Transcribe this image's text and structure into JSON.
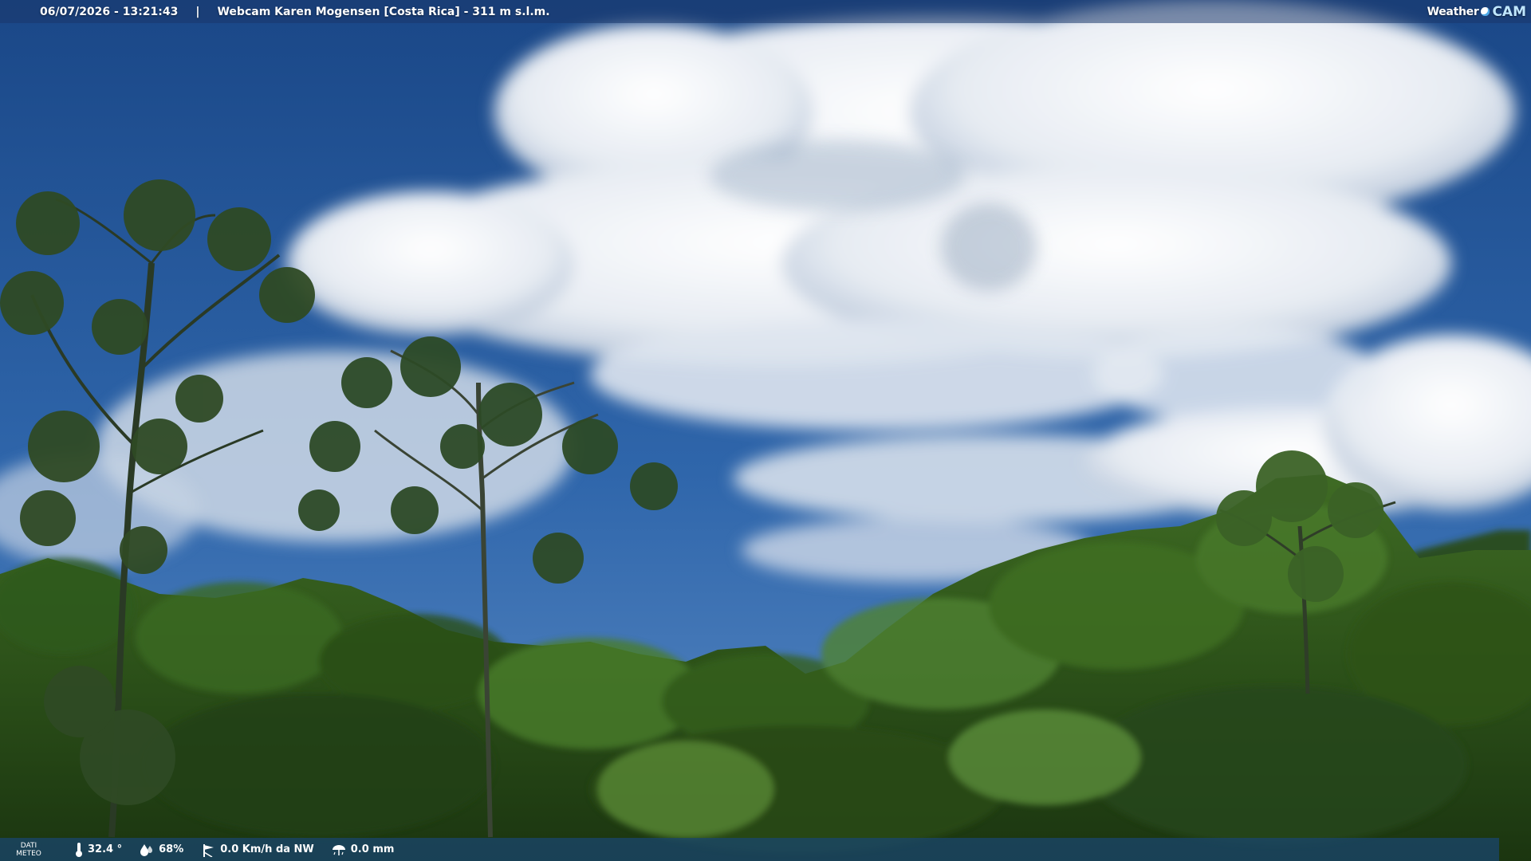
{
  "header": {
    "datetime": "06/07/2026 - 13:21:43",
    "separator": "|",
    "title": "Webcam Karen Mogensen [Costa Rica]  - 311 m s.l.m."
  },
  "logo": {
    "weather": "Weather",
    "cam": "CAM"
  },
  "meteo": {
    "label_line1": "DATI",
    "label_line2": "METEO",
    "temperature": "32.4 °",
    "humidity": "68%",
    "wind": "0.0 Km/h da NW",
    "rain": "0.0 mm"
  },
  "icons": {
    "temperature": "thermometer-icon",
    "humidity": "humidity-drop-icon",
    "wind": "wind-vane-icon",
    "rain": "rain-gauge-icon"
  },
  "colors": {
    "sky_top": "#1d4d8f",
    "sky_low": "#3b72b4",
    "cloud": "#f2f4f7",
    "forest_dark": "#1f3a17",
    "forest_light": "#4d7a2c"
  }
}
